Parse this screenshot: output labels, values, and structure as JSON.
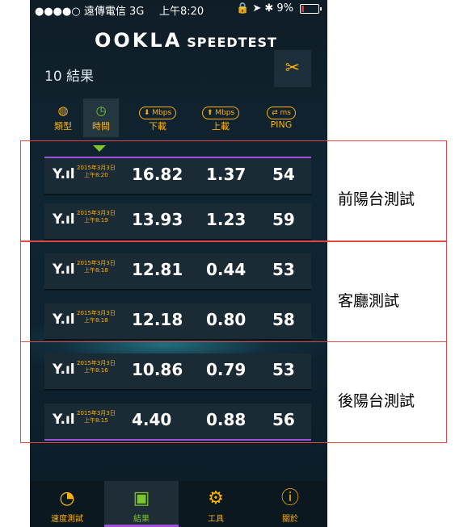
{
  "status_bar": {
    "carrier": "●●●●○ 遠傳電信  3G",
    "time": "上午8:20",
    "battery": "9%"
  },
  "header": {
    "logo": "OOKLA",
    "logo_sub": "SPEEDTEST",
    "result_count": "10 結果"
  },
  "tabs": [
    {
      "label": "類型",
      "icon": "globe-icon",
      "active": false
    },
    {
      "label": "時間",
      "icon": "clock-icon",
      "active": true
    },
    {
      "label": "下載",
      "icon": "download-icon",
      "unit": "Mbps"
    },
    {
      "label": "上載",
      "icon": "upload-icon",
      "unit": "Mbps"
    },
    {
      "label": "PING",
      "icon": "ping-icon",
      "unit": "ms"
    }
  ],
  "results": [
    {
      "date": "2015年3月3日",
      "time": "上午8:20",
      "download": "16.82",
      "upload": "1.37",
      "ping": "54"
    },
    {
      "date": "2015年3月3日",
      "time": "上午8:19",
      "download": "13.93",
      "upload": "1.23",
      "ping": "59"
    },
    {
      "date": "2015年3月3日",
      "time": "上午8:18",
      "download": "12.81",
      "upload": "0.44",
      "ping": "53"
    },
    {
      "date": "2015年3月3日",
      "time": "上午8:18",
      "download": "12.18",
      "upload": "0.80",
      "ping": "58"
    },
    {
      "date": "2015年3月3日",
      "time": "上午8:16",
      "download": "10.86",
      "upload": "0.79",
      "ping": "53"
    },
    {
      "date": "2015年3月3日",
      "time": "上午8:15",
      "download": "4.40",
      "upload": "0.88",
      "ping": "56"
    }
  ],
  "bottom_nav": [
    {
      "label": "速度測試",
      "icon": "speedometer-icon"
    },
    {
      "label": "結果",
      "icon": "results-folder-icon",
      "active": true
    },
    {
      "label": "工具",
      "icon": "gear-icon"
    },
    {
      "label": "關於",
      "icon": "info-icon"
    }
  ],
  "annotations": [
    "前陽台測試",
    "客廳測試",
    "後陽台測試"
  ],
  "colors": {
    "accent": "#ffb300",
    "active_green": "#7dc52f",
    "glow": "#a050d8",
    "box": "#e04848"
  }
}
